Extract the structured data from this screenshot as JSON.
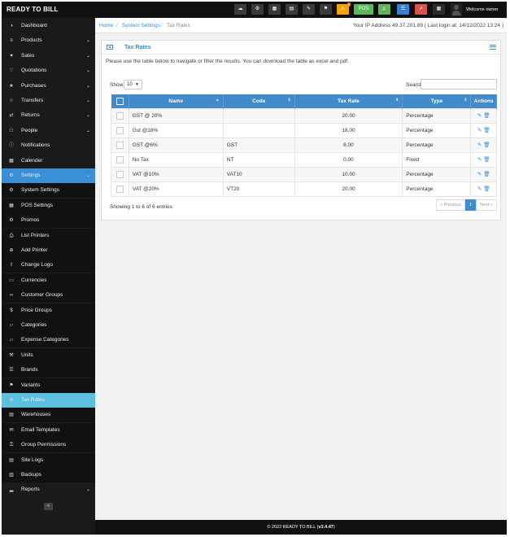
{
  "brand": "READY TO BILL",
  "topbar": {
    "pos_label": "POS",
    "welcome": "Welcome owner",
    "icons": [
      "dashboard-icon",
      "settings-icon",
      "calculator-icon",
      "calendar-icon",
      "notes-icon",
      "flag-icon",
      "alert-icon",
      "pos-icon",
      "hourglass-icon",
      "list-icon",
      "rocket-icon",
      "grid-icon"
    ],
    "warn_badge": "1"
  },
  "sidebar": {
    "items": [
      {
        "label": "Dashboard",
        "icon": "dashboard-icon",
        "chev": false
      },
      {
        "label": "Products",
        "icon": "barcode-icon",
        "chev": true
      },
      {
        "label": "Sales",
        "icon": "heart-icon",
        "chev": true
      },
      {
        "label": "Quotations",
        "icon": "heart-outline-icon",
        "chev": true
      },
      {
        "label": "Purchases",
        "icon": "star-icon",
        "chev": true
      },
      {
        "label": "Transfers",
        "icon": "star-outline-icon",
        "chev": true
      },
      {
        "label": "Returns",
        "icon": "shuffle-icon",
        "chev": true
      },
      {
        "label": "People",
        "icon": "users-icon",
        "chev": true
      },
      {
        "label": "Notifications",
        "icon": "info-icon",
        "chev": false
      },
      {
        "label": "Calender",
        "icon": "calendar-icon",
        "chev": false
      },
      {
        "label": "Settings",
        "icon": "cog-icon",
        "chev": true
      },
      {
        "label": "System Settings",
        "icon": "cogs-icon",
        "chev": false
      },
      {
        "label": "POS Settings",
        "icon": "th-icon",
        "chev": false
      },
      {
        "label": "Promos",
        "icon": "cogs-icon",
        "chev": false
      },
      {
        "label": "List Printers",
        "icon": "print-icon",
        "chev": false
      },
      {
        "label": "Add Printer",
        "icon": "plus-circle-icon",
        "chev": false
      },
      {
        "label": "Change Logo",
        "icon": "upload-icon",
        "chev": false
      },
      {
        "label": "Currencies",
        "icon": "money-icon",
        "chev": false
      },
      {
        "label": "Customer Groups",
        "icon": "chain-icon",
        "chev": false
      },
      {
        "label": "Price Groups",
        "icon": "dollar-icon",
        "chev": false
      },
      {
        "label": "Categories",
        "icon": "folder-open-icon",
        "chev": false
      },
      {
        "label": "Expense Categories",
        "icon": "folder-open-icon",
        "chev": false
      },
      {
        "label": "Units",
        "icon": "wrench-icon",
        "chev": false
      },
      {
        "label": "Brands",
        "icon": "th-list-icon",
        "chev": false
      },
      {
        "label": "Variants",
        "icon": "tags-icon",
        "chev": false
      },
      {
        "label": "Tax Rates",
        "icon": "plus-circle-icon",
        "chev": false
      },
      {
        "label": "Warehouses",
        "icon": "building-icon",
        "chev": false
      },
      {
        "label": "Email Templates",
        "icon": "envelope-icon",
        "chev": false
      },
      {
        "label": "Group Permissions",
        "icon": "key-icon",
        "chev": false
      },
      {
        "label": "Site Logs",
        "icon": "file-text-icon",
        "chev": false
      },
      {
        "label": "Backups",
        "icon": "database-icon",
        "chev": false
      },
      {
        "label": "Reports",
        "icon": "bar-chart-icon",
        "chev": true
      }
    ],
    "collapse": "«"
  },
  "breadcrumb": {
    "home": "Home",
    "sep": "/",
    "section": "System Settings",
    "current": "Tax Rates"
  },
  "ip_info": "Your IP Address 49.37.201.89 ( Last login at: 14/12/2022 13:24 )",
  "panel": {
    "title": "Tax Rates",
    "intro": "Please use the table below to navigate or filter the results. You can download the table as excel and pdf.",
    "show_label": "Show",
    "page_length": "10",
    "search_label": "Search"
  },
  "table": {
    "columns": [
      "Name",
      "Code",
      "Tax Rate",
      "Type",
      "Actions"
    ],
    "rows": [
      {
        "name": "GST @ 20%",
        "code": "",
        "rate": "20.00",
        "type": "Percentage"
      },
      {
        "name": "Gst @18%",
        "code": "",
        "rate": "18.00",
        "type": "Percentage"
      },
      {
        "name": "GST @6%",
        "code": "GST",
        "rate": "6.00",
        "type": "Percentage"
      },
      {
        "name": "No Tax",
        "code": "NT",
        "rate": "0.00",
        "type": "Fixed"
      },
      {
        "name": "VAT @10%",
        "code": "VAT10",
        "rate": "10.00",
        "type": "Percentage"
      },
      {
        "name": "VAT @20%",
        "code": "VT20",
        "rate": "20.00",
        "type": "Percentage"
      }
    ]
  },
  "showing": "Showing 1 to 6 of 6 entries",
  "pager": {
    "prev": "« Previous",
    "page": "1",
    "next": "Next »"
  },
  "footer": {
    "prefix": "© 2022 READY TO BILL (",
    "version": "v3.4.47",
    "suffix": ")"
  },
  "colors": {
    "accent": "#428bca",
    "active_parent": "#3a8fd9",
    "active_sub": "#5bc0de",
    "sidebar_bg": "#1a1a1a"
  }
}
